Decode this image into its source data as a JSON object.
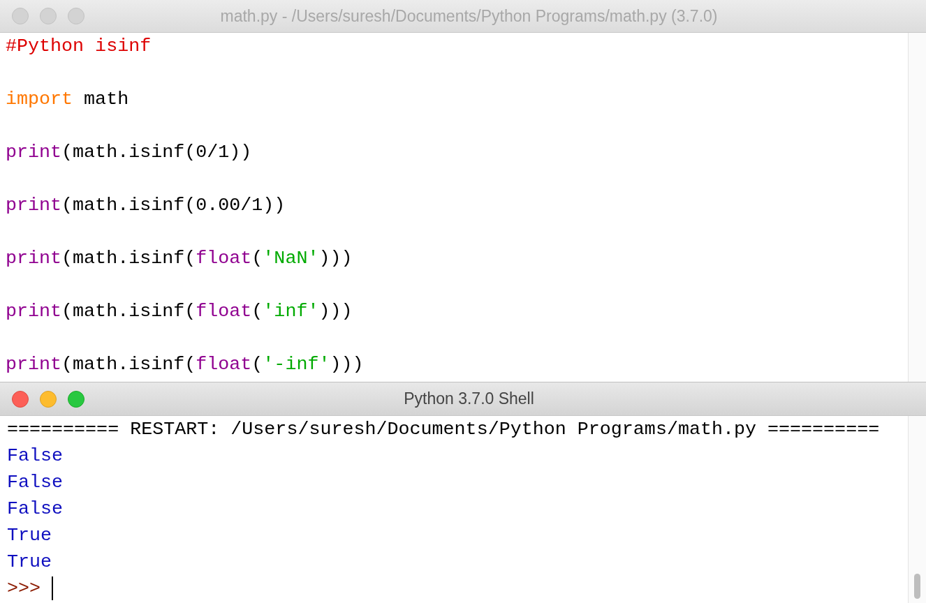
{
  "editor": {
    "title": "math.py - /Users/suresh/Documents/Python Programs/math.py (3.7.0)",
    "focused": false,
    "lines": [
      {
        "tokens": [
          {
            "kind": "comment",
            "text": "#Python isinf"
          }
        ]
      },
      {
        "tokens": [
          {
            "kind": "keyword",
            "text": "import"
          },
          {
            "kind": "plain",
            "text": " math"
          }
        ]
      },
      {
        "tokens": [
          {
            "kind": "builtin",
            "text": "print"
          },
          {
            "kind": "plain",
            "text": "(math.isinf(0/1))"
          }
        ]
      },
      {
        "tokens": [
          {
            "kind": "builtin",
            "text": "print"
          },
          {
            "kind": "plain",
            "text": "(math.isinf(0.00/1))"
          }
        ]
      },
      {
        "tokens": [
          {
            "kind": "builtin",
            "text": "print"
          },
          {
            "kind": "plain",
            "text": "(math.isinf("
          },
          {
            "kind": "builtin",
            "text": "float"
          },
          {
            "kind": "plain",
            "text": "("
          },
          {
            "kind": "string",
            "text": "'NaN'"
          },
          {
            "kind": "plain",
            "text": ")))"
          }
        ]
      },
      {
        "tokens": [
          {
            "kind": "builtin",
            "text": "print"
          },
          {
            "kind": "plain",
            "text": "(math.isinf("
          },
          {
            "kind": "builtin",
            "text": "float"
          },
          {
            "kind": "plain",
            "text": "("
          },
          {
            "kind": "string",
            "text": "'inf'"
          },
          {
            "kind": "plain",
            "text": ")))"
          }
        ]
      },
      {
        "tokens": [
          {
            "kind": "builtin",
            "text": "print"
          },
          {
            "kind": "plain",
            "text": "(math.isinf("
          },
          {
            "kind": "builtin",
            "text": "float"
          },
          {
            "kind": "plain",
            "text": "("
          },
          {
            "kind": "string",
            "text": "'-inf'"
          },
          {
            "kind": "plain",
            "text": ")))"
          }
        ]
      }
    ]
  },
  "shell": {
    "title": "Python 3.7.0 Shell",
    "focused": true,
    "lines": [
      {
        "kind": "restart",
        "text": "========== RESTART: /Users/suresh/Documents/Python Programs/math.py =========="
      },
      {
        "kind": "output",
        "text": "False"
      },
      {
        "kind": "output",
        "text": "False"
      },
      {
        "kind": "output",
        "text": "False"
      },
      {
        "kind": "output",
        "text": "True"
      },
      {
        "kind": "output",
        "text": "True"
      },
      {
        "kind": "prompt",
        "text": ">>>"
      }
    ]
  }
}
